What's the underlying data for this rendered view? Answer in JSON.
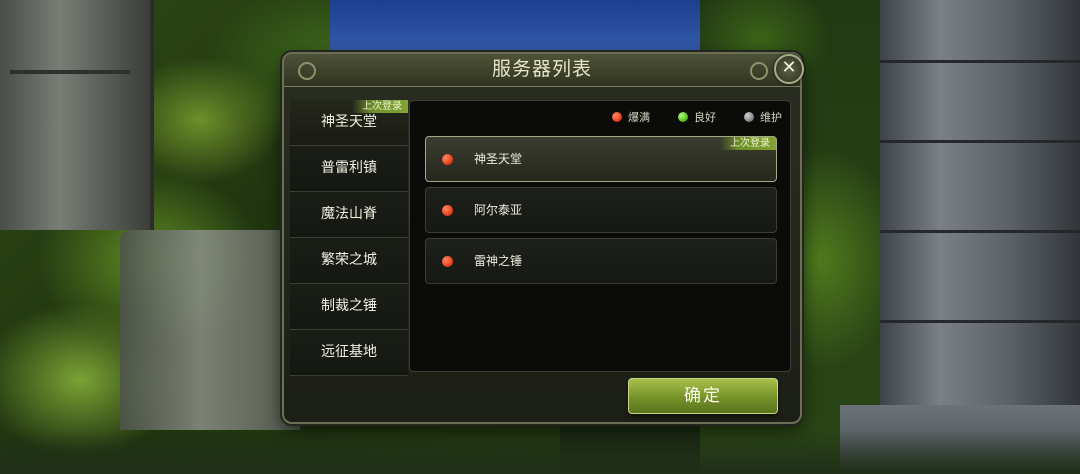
{
  "dialog": {
    "title": "服务器列表",
    "confirm_label": "确定"
  },
  "legend": [
    {
      "label": "爆满",
      "color": "#e8431e"
    },
    {
      "label": "良好",
      "color": "#57c41f"
    },
    {
      "label": "维护",
      "color": "#8a8a8a"
    }
  ],
  "regions": [
    {
      "label": "神圣天堂",
      "tag": "上次登录",
      "active": true
    },
    {
      "label": "普雷利镇"
    },
    {
      "label": "魔法山脊"
    },
    {
      "label": "繁荣之城"
    },
    {
      "label": "制裁之锤"
    },
    {
      "label": "远征基地"
    }
  ],
  "servers": [
    {
      "name": "神圣天堂",
      "status": "爆满",
      "tag": "上次登录",
      "selected": true
    },
    {
      "name": "阿尔泰亚",
      "status": "爆满"
    },
    {
      "name": "雷神之锤",
      "status": "爆满"
    }
  ],
  "colors": {
    "status_full": "#e8431e",
    "status_good": "#57c41f",
    "status_maintenance": "#8a8a8a",
    "accent": "#84a533"
  }
}
